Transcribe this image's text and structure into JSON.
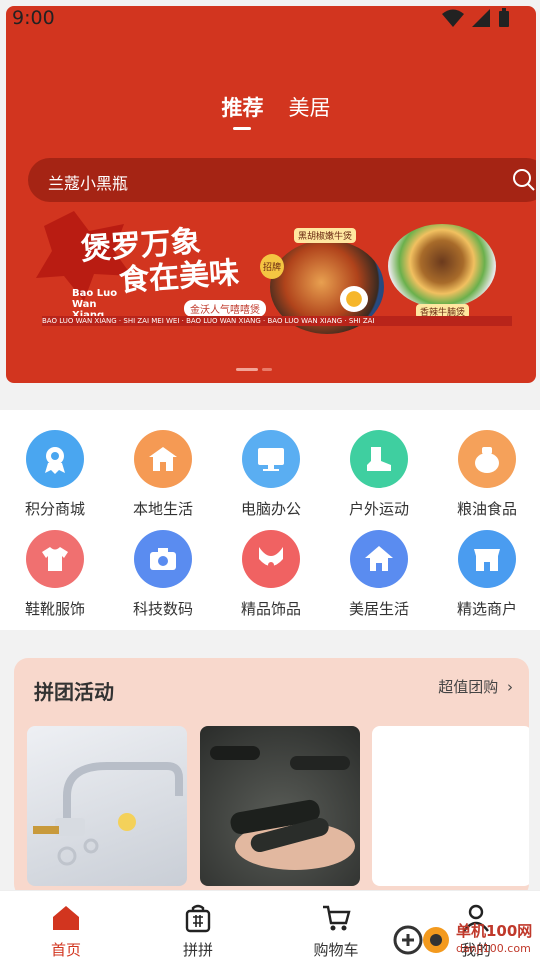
{
  "status_bar": {
    "time": "9:00"
  },
  "header": {
    "tabs": [
      {
        "label": "推荐",
        "active": true
      },
      {
        "label": "美居",
        "active": false
      }
    ],
    "search": {
      "placeholder": "兰蔻小黑瓶"
    }
  },
  "banner": {
    "title_line1": "煲罗万象",
    "title_line2": "食在美味",
    "brand": "Bao Luo Wan Xiang",
    "promo": "金沃人气嘻嘻煲",
    "tag1": "黑胡椒嫩牛煲",
    "tag2": "香辣牛腩煲",
    "badge": "招牌",
    "stripe": "BAO LUO WAN XIANG · SHI ZAI MEI WEI · BAO LUO WAN XIANG · BAO LUO WAN XIANG · SHI ZAI"
  },
  "categories": [
    {
      "label": "积分商城",
      "icon": "badge-icon",
      "color": "#4aa6f0"
    },
    {
      "label": "本地生活",
      "icon": "house-icon",
      "color": "#f59a54"
    },
    {
      "label": "电脑办公",
      "icon": "monitor-icon",
      "color": "#5aaef2"
    },
    {
      "label": "户外运动",
      "icon": "boot-icon",
      "color": "#3fcfa0"
    },
    {
      "label": "粮油食品",
      "icon": "sack-icon",
      "color": "#f5a15a"
    },
    {
      "label": "鞋靴服饰",
      "icon": "shirt-icon",
      "color": "#f07070"
    },
    {
      "label": "科技数码",
      "icon": "camera-icon",
      "color": "#5a8cf0"
    },
    {
      "label": "精品饰品",
      "icon": "necklace-icon",
      "color": "#f06262"
    },
    {
      "label": "美居生活",
      "icon": "home-icon",
      "color": "#5a8cf0"
    },
    {
      "label": "精选商户",
      "icon": "store-icon",
      "color": "#4a9cf0"
    }
  ],
  "group_buy": {
    "title": "拼团活动",
    "more": "超值团购"
  },
  "nav": [
    {
      "label": "首页",
      "icon": "home-icon",
      "active": true
    },
    {
      "label": "拼拼",
      "icon": "bag-icon",
      "active": false
    },
    {
      "label": "购物车",
      "icon": "cart-icon",
      "active": false
    },
    {
      "label": "我的",
      "icon": "person-icon",
      "active": false
    }
  ],
  "watermark": {
    "text": "单机100网",
    "sub": "danji100.com"
  },
  "colors": {
    "brand_red": "#d2351f",
    "group_bg": "#f8d8cc"
  }
}
